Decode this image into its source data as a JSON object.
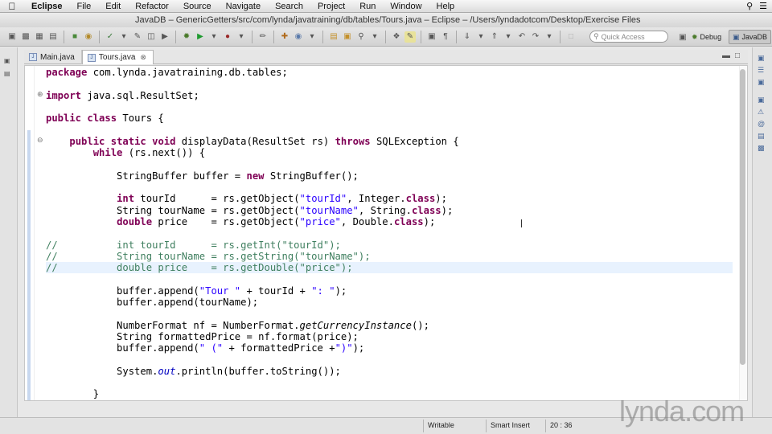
{
  "menubar": {
    "app": "Eclipse",
    "items": [
      "File",
      "Edit",
      "Refactor",
      "Source",
      "Navigate",
      "Search",
      "Project",
      "Run",
      "Window",
      "Help"
    ]
  },
  "window": {
    "title": "JavaDB – GenericGetters/src/com/lynda/javatraining/db/tables/Tours.java – Eclipse – /Users/lyndadotcom/Desktop/Exercise Files"
  },
  "toolbar": {
    "quick_access_placeholder": "Quick Access",
    "perspectives": [
      "Debug",
      "JavaDB"
    ]
  },
  "tabs": [
    {
      "label": "Main.java",
      "active": false
    },
    {
      "label": "Tours.java",
      "active": true
    }
  ],
  "code_lines": [
    {
      "text": "package com.lynda.javatraining.db.tables;"
    },
    {
      "text": ""
    },
    {
      "text": "import java.sql.ResultSet;"
    },
    {
      "text": ""
    },
    {
      "text": "public class Tours {"
    },
    {
      "text": ""
    },
    {
      "text": "    public static void displayData(ResultSet rs) throws SQLException {"
    },
    {
      "text": "        while (rs.next()) {"
    },
    {
      "text": ""
    },
    {
      "text": "            StringBuffer buffer = new StringBuffer();"
    },
    {
      "text": ""
    },
    {
      "text": "            int tourId      = rs.getObject(\"tourId\", Integer.class);"
    },
    {
      "text": "            String tourName = rs.getObject(\"tourName\", String.class);"
    },
    {
      "text": "            double price    = rs.getObject(\"price\", Double.class);"
    },
    {
      "text": ""
    },
    {
      "text": "//          int tourId      = rs.getInt(\"tourId\");"
    },
    {
      "text": "//          String tourName = rs.getString(\"tourName\");"
    },
    {
      "text": "//          double price    = rs.getDouble(\"price\");"
    },
    {
      "text": ""
    },
    {
      "text": "            buffer.append(\"Tour \" + tourId + \": \");"
    },
    {
      "text": "            buffer.append(tourName);"
    },
    {
      "text": ""
    },
    {
      "text": "            NumberFormat nf = NumberFormat.getCurrencyInstance();"
    },
    {
      "text": "            String formattedPrice = nf.format(price);"
    },
    {
      "text": "            buffer.append(\" (\" + formattedPrice +\")\");"
    },
    {
      "text": ""
    },
    {
      "text": "            System.out.println(buffer.toString());"
    },
    {
      "text": ""
    },
    {
      "text": "        }"
    }
  ],
  "status": {
    "writable": "Writable",
    "insert_mode": "Smart Insert",
    "position": "20 : 36"
  },
  "watermark": "lynda.com"
}
